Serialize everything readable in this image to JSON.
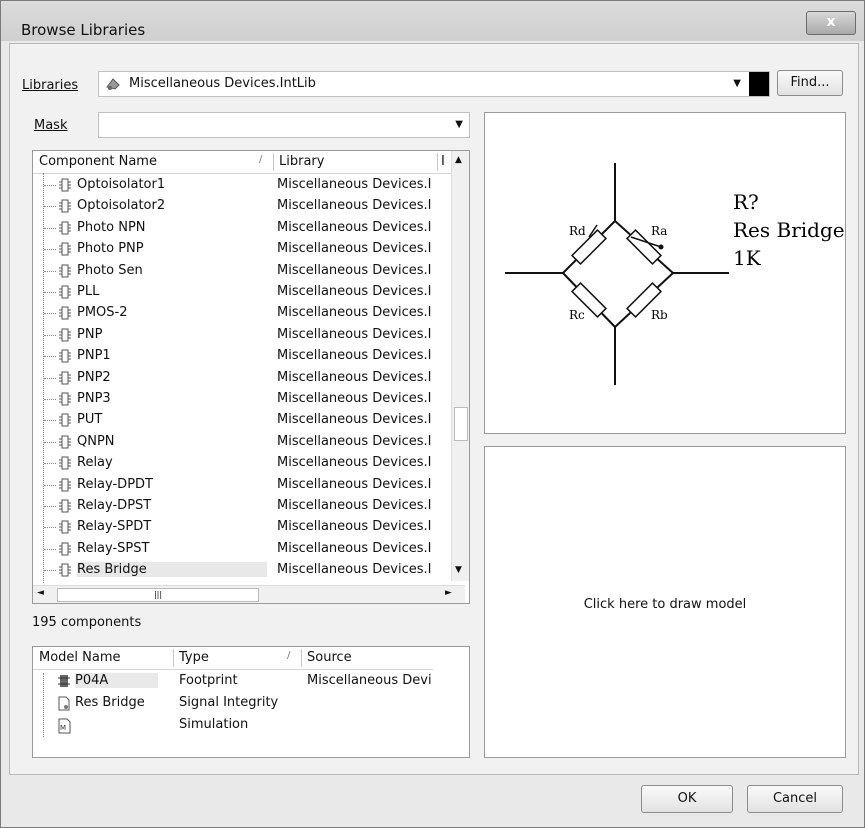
{
  "window": {
    "title": "Browse Libraries",
    "close_label": "x"
  },
  "libraries": {
    "label": "Libraries",
    "value": "Miscellaneous Devices.IntLib",
    "find_label": "Find..."
  },
  "mask": {
    "label": "Mask",
    "value": ""
  },
  "components": {
    "headers": [
      "Component Name",
      "Library",
      "I"
    ],
    "rows": [
      {
        "name": "Optoisolator1",
        "library": "Miscellaneous Devices.I"
      },
      {
        "name": "Optoisolator2",
        "library": "Miscellaneous Devices.I"
      },
      {
        "name": "Photo NPN",
        "library": "Miscellaneous Devices.I"
      },
      {
        "name": "Photo PNP",
        "library": "Miscellaneous Devices.I"
      },
      {
        "name": "Photo Sen",
        "library": "Miscellaneous Devices.I"
      },
      {
        "name": "PLL",
        "library": "Miscellaneous Devices.I"
      },
      {
        "name": "PMOS-2",
        "library": "Miscellaneous Devices.I"
      },
      {
        "name": "PNP",
        "library": "Miscellaneous Devices.I"
      },
      {
        "name": "PNP1",
        "library": "Miscellaneous Devices.I"
      },
      {
        "name": "PNP2",
        "library": "Miscellaneous Devices.I"
      },
      {
        "name": "PNP3",
        "library": "Miscellaneous Devices.I"
      },
      {
        "name": "PUT",
        "library": "Miscellaneous Devices.I"
      },
      {
        "name": "QNPN",
        "library": "Miscellaneous Devices.I"
      },
      {
        "name": "Relay",
        "library": "Miscellaneous Devices.I"
      },
      {
        "name": "Relay-DPDT",
        "library": "Miscellaneous Devices.I"
      },
      {
        "name": "Relay-DPST",
        "library": "Miscellaneous Devices.I"
      },
      {
        "name": "Relay-SPDT",
        "library": "Miscellaneous Devices.I"
      },
      {
        "name": "Relay-SPST",
        "library": "Miscellaneous Devices.I"
      },
      {
        "name": "Res Bridge",
        "library": "Miscellaneous Devices.I"
      }
    ],
    "selected": "Res Bridge",
    "count_text": "195 components"
  },
  "models": {
    "headers": [
      "Model Name",
      "Type",
      "Source"
    ],
    "rows": [
      {
        "name": "P04A",
        "type": "Footprint",
        "source": "Miscellaneous Devi"
      },
      {
        "name": "Res Bridge",
        "type": "Signal Integrity",
        "source": ""
      },
      {
        "name": "",
        "type": "Simulation",
        "source": ""
      }
    ]
  },
  "preview": {
    "designator": "R?",
    "comment": "Res Bridge",
    "value": "1K",
    "labels": {
      "ra": "Ra",
      "rb": "Rb",
      "rc": "Rc",
      "rd": "Rd"
    }
  },
  "model_preview": {
    "hint": "Click here to draw model"
  },
  "footer": {
    "ok_label": "OK",
    "cancel_label": "Cancel"
  },
  "icons": {
    "library-icon": "library-icon",
    "component-icon": "component-icon",
    "footprint-icon": "footprint-icon",
    "signal-icon": "signal-icon",
    "sim-icon": "sim-icon"
  }
}
